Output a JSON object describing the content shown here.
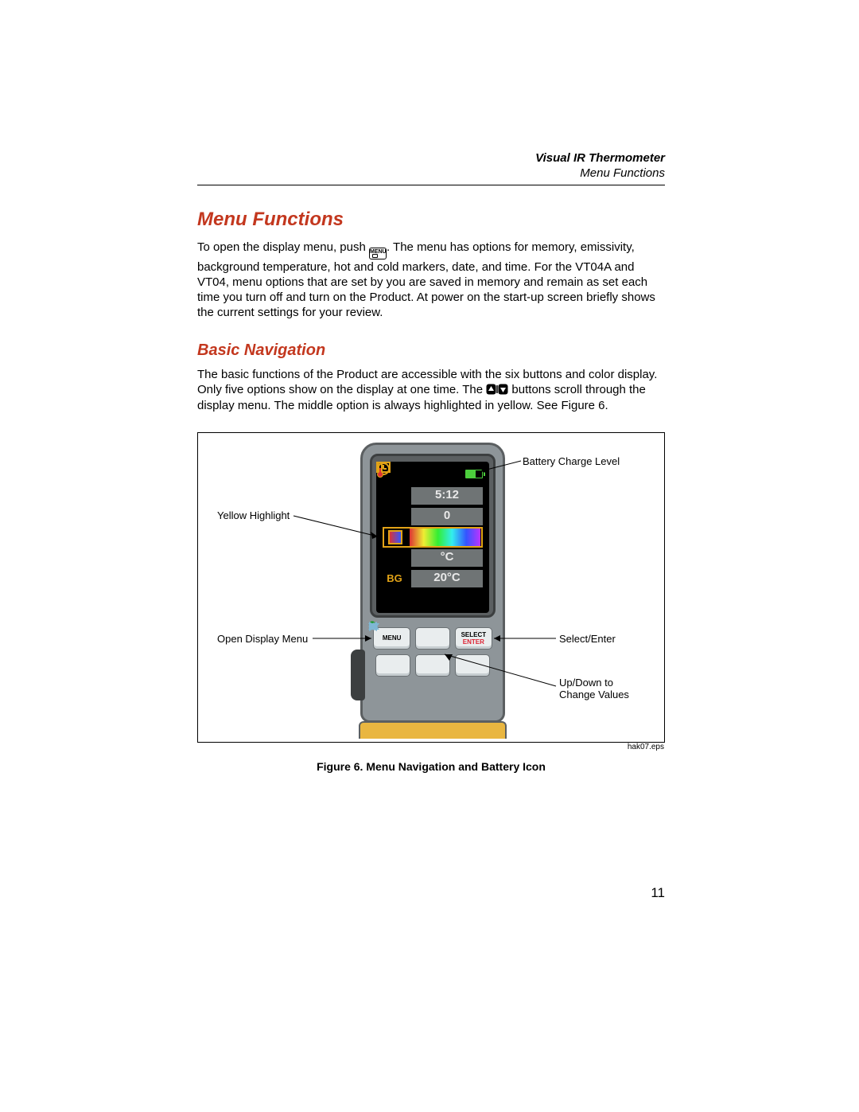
{
  "running_head": {
    "title": "Visual IR Thermometer",
    "subtitle": "Menu Functions"
  },
  "h1": "Menu Functions",
  "p1a": "To open the display menu, push ",
  "p1_icon_name": "menu-power-button-icon",
  "p1b": ". The menu has options for memory, emissivity, background temperature, hot and cold markers, date, and time. For the VT04A and VT04, menu options that are set by you are saved in memory and remain as set each time you turn off and turn on the Product. At power on the start-up screen briefly shows the current settings for your review.",
  "h2": "Basic Navigation",
  "p2a": "The basic functions of the Product are accessible with the six buttons and color display. Only five options show on the display at one time. The ",
  "p2_icon_name": "up-down-buttons-icon",
  "p2b": " buttons scroll through the display menu. The middle option is always highlighted in yellow. See Figure 6.",
  "figure": {
    "callouts": {
      "yellow_highlight": "Yellow Highlight",
      "open_display_menu": "Open Display Menu",
      "battery_charge": "Battery Charge Level",
      "select_enter": "Select/Enter",
      "up_down": "Up/Down to\nChange Values"
    },
    "buttons": {
      "menu": "MENU",
      "select": "SELECT",
      "enter": "ENTER"
    },
    "screen": {
      "rows": {
        "time": "5:12",
        "count": "0",
        "unit": "°C",
        "bg_label": "BG",
        "bg_val": "20°C"
      }
    },
    "eps": "hak07.eps",
    "caption": "Figure 6. Menu Navigation and Battery Icon"
  },
  "page_number": "11"
}
